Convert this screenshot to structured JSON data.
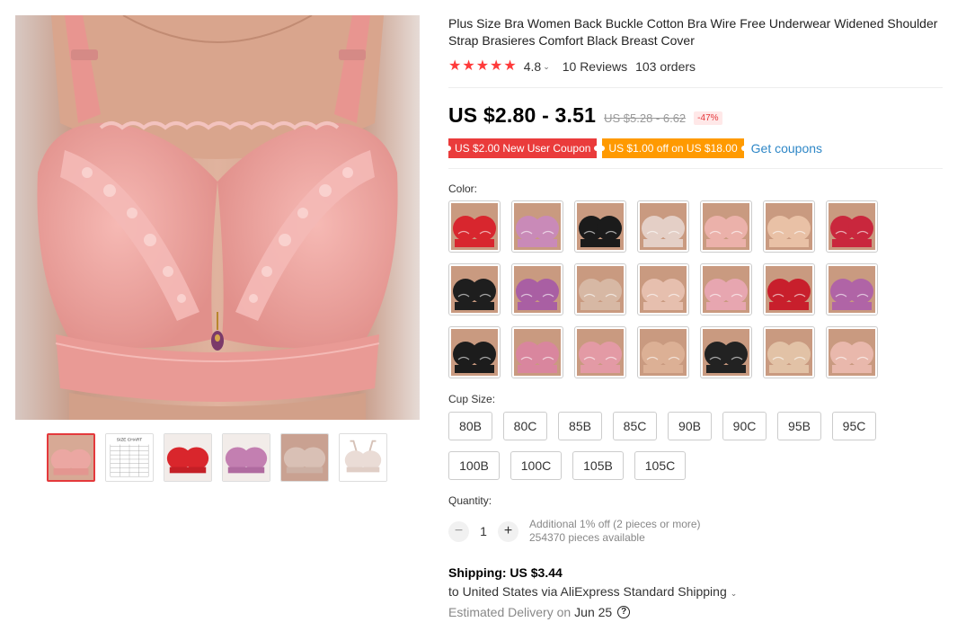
{
  "product": {
    "title": "Plus Size Bra Women Back Buckle Cotton Bra Wire Free Underwear Widened Shoulder Strap Brasieres Comfort Black Breast Cover",
    "rating": "4.8",
    "stars": 5,
    "reviews": "10 Reviews",
    "orders": "103 orders"
  },
  "price": {
    "current": "US $2.80 - 3.51",
    "original": "US $5.28 - 6.62",
    "discount": "-47%"
  },
  "coupons": {
    "new_user": "US $2.00 New User Coupon",
    "store": "US $1.00 off on US $18.00",
    "get_link": "Get coupons"
  },
  "colors": {
    "label": "Color:",
    "swatches": [
      "#d8262e",
      "#c98ab8",
      "#1b1b1b",
      "#e4cfc6",
      "#ebb1aa",
      "#e9c1a6",
      "#c9273d",
      "#1e1e1e",
      "#a95fa3",
      "#d7b8a4",
      "#e6bfae",
      "#e7a6b0",
      "#c81f2c",
      "#b064a6",
      "#1c1c1c",
      "#d9869e",
      "#e39aa5",
      "#dcb095",
      "#222222",
      "#e2c2a6",
      "#e9b8ac"
    ],
    "accents": {
      "skin": "#c99a80",
      "highlight": "#ffffff"
    }
  },
  "cup_size": {
    "label": "Cup Size:",
    "options": [
      "80B",
      "80C",
      "85B",
      "85C",
      "90B",
      "90C",
      "95B",
      "95C",
      "100B",
      "100C",
      "105B",
      "105C"
    ]
  },
  "quantity": {
    "label": "Quantity:",
    "value": "1",
    "minus": "−",
    "plus": "+",
    "note1": "Additional 1% off (2 pieces or more)",
    "note2": "254370 pieces available"
  },
  "shipping": {
    "title": "Shipping: US $3.44",
    "line": "to United States via AliExpress Standard Shipping",
    "delivery_label": "Estimated Delivery on",
    "delivery_date": "Jun 25",
    "help": "?"
  },
  "gallery": {
    "size_chart_label": "SIZE CHART",
    "thumb_colors": [
      "#eba7a2",
      "#ffffff",
      "#d9262c",
      "#c37fb1",
      "#d9c0b5",
      "#eadcd6"
    ]
  },
  "theme": {
    "accent": "#e4393c",
    "coupon_red": "#ea3b3b",
    "coupon_orange": "#ff9a00",
    "link": "#2e87c7"
  }
}
